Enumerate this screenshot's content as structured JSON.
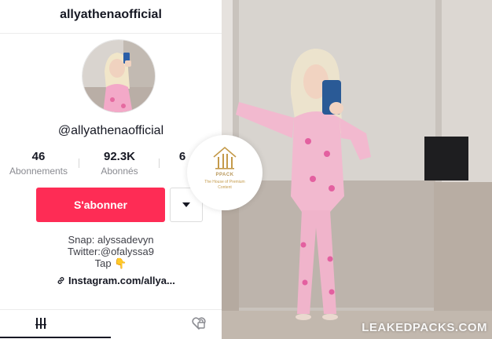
{
  "profile": {
    "username": "allyathenaofficial",
    "handle": "@allyathenaofficial",
    "stats": [
      {
        "value": "46",
        "label": "Abonnements"
      },
      {
        "value": "92.3K",
        "label": "Abonnés"
      },
      {
        "value": "6",
        "label": ""
      }
    ],
    "follow_label": "S'abonner",
    "bio": [
      "Snap: alyssadevyn",
      "Twitter:@ofalyssa9",
      "Tap 👇"
    ],
    "link": "Instagram.com/allya..."
  },
  "badge": {
    "name": "PPACK",
    "tagline": "The House of Premium Content"
  },
  "photo": {
    "watermark": "LEAKEDPACKS.COM"
  },
  "colors": {
    "follow_button": "#fe2c55",
    "badge_gold": "#c49a4a"
  },
  "icons": [
    "link-icon",
    "chevron-down-icon",
    "grid-icon",
    "liked-icon",
    "house-icon"
  ]
}
